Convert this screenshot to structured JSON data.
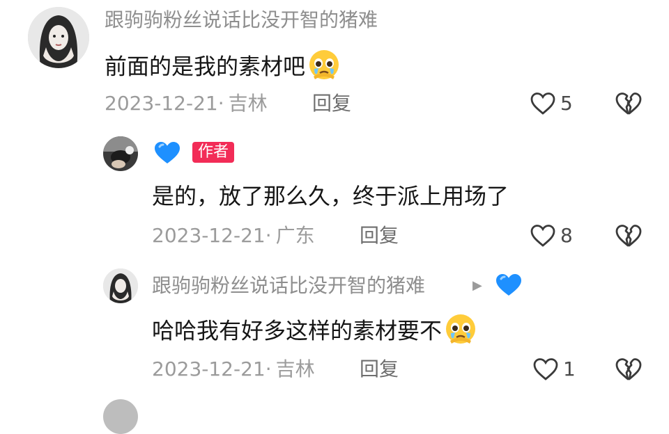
{
  "colors": {
    "author_badge_bg": "#f22c57",
    "heart_emoji": "#1e90ff",
    "meta_text": "#9b9b9b"
  },
  "comments": [
    {
      "username": "跟驹驹粉丝说话比没开智的猪难",
      "text": "前面的是我的素材吧",
      "emoji": "pleading-face-emoji",
      "date": "2023-12-21·",
      "location": "吉林",
      "reply_label": "回复",
      "likes": "5"
    },
    {
      "username_emoji": "blue-heart-emoji",
      "badge": "作者",
      "text": "是的，放了那么久，终于派上用场了",
      "date": "2023-12-21·",
      "location": "广东",
      "reply_label": "回复",
      "likes": "8"
    },
    {
      "username": "跟驹驹粉丝说话比没开智的猪难",
      "reply_to_emoji": "blue-heart-emoji",
      "text": "哈哈我有好多这样的素材要不",
      "emoji": "pleading-face-emoji",
      "date": "2023-12-21·",
      "location": "吉林",
      "reply_label": "回复",
      "likes": "1"
    }
  ]
}
